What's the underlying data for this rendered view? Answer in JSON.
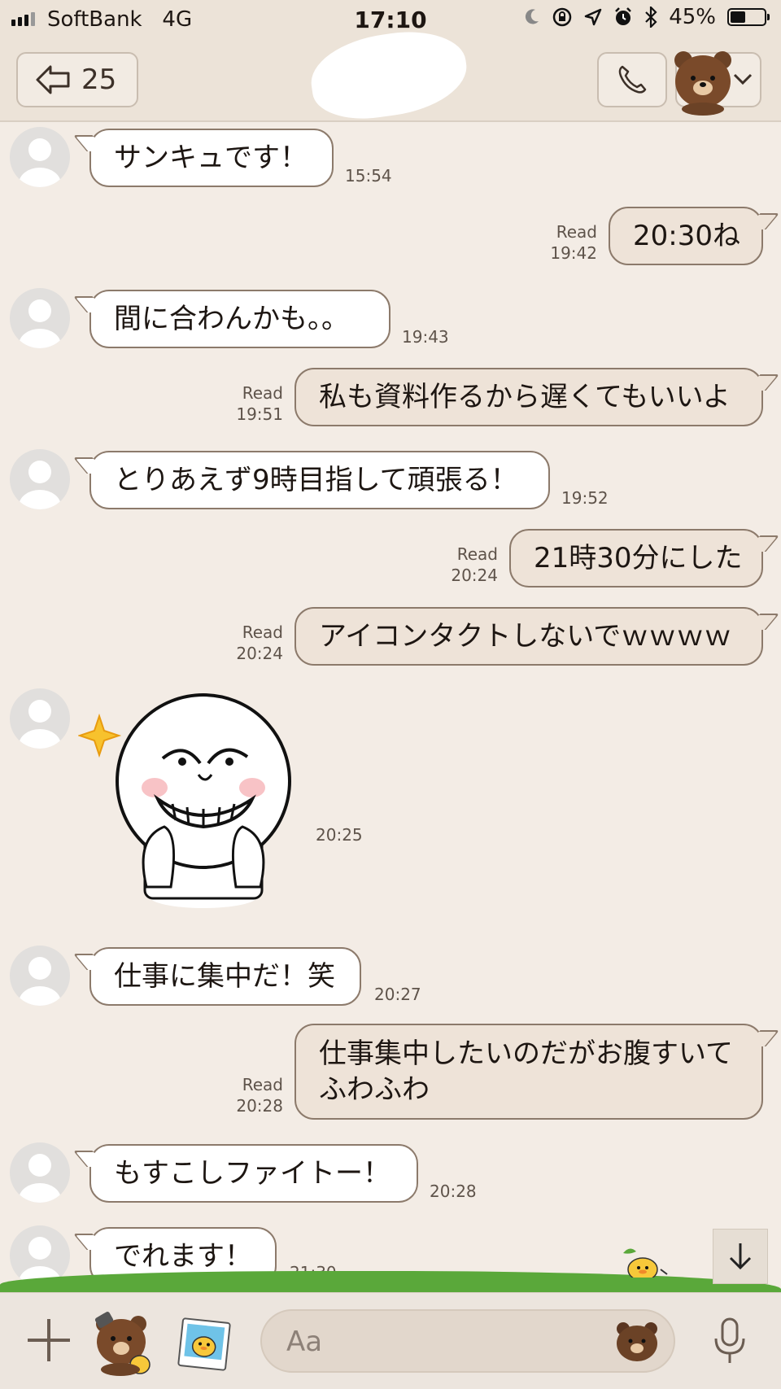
{
  "status": {
    "carrier": "SoftBank",
    "network": "4G",
    "time": "17:10",
    "battery": "45%",
    "battery_level": 0.45
  },
  "header": {
    "unread_count": "25"
  },
  "messages": [
    {
      "dir": "in",
      "text": "サンキュです！",
      "time": "15:54"
    },
    {
      "dir": "out",
      "text": "20:30ね",
      "time": "19:42",
      "read": "Read"
    },
    {
      "dir": "in",
      "text": "間に合わんかも。。",
      "time": "19:43"
    },
    {
      "dir": "out",
      "text": "私も資料作るから遅くてもいいよ",
      "time": "19:51",
      "read": "Read"
    },
    {
      "dir": "in",
      "text": "とりあえず9時目指して頑張る！",
      "time": "19:52"
    },
    {
      "dir": "out",
      "text": "21時30分にした",
      "time": "20:24",
      "read": "Read"
    },
    {
      "dir": "out",
      "text": "アイコンタクトしないでｗｗｗｗ",
      "time": "20:24",
      "read": "Read"
    },
    {
      "dir": "in",
      "type": "sticker",
      "time": "20:25"
    },
    {
      "dir": "in",
      "text": "仕事に集中だ！笑",
      "time": "20:27"
    },
    {
      "dir": "out",
      "text_line1": "仕事集中したいのだがお腹すいて",
      "text_line2": "ふわふわ",
      "time": "20:28",
      "read": "Read"
    },
    {
      "dir": "in",
      "text": "もすこしファイトー！",
      "time": "20:28"
    },
    {
      "dir": "in",
      "text": "でれます！",
      "time": "21:30"
    }
  ],
  "input": {
    "placeholder": "Aa"
  },
  "icons": {
    "back": "back-arrow-icon",
    "call": "phone-icon",
    "menu": "bear-avatar-icon",
    "plus": "plus-icon",
    "sticker": "sticker-icon",
    "photo": "photo-icon",
    "emoji": "emoji-icon",
    "mic": "microphone-icon",
    "scroll": "arrow-down-icon"
  },
  "colors": {
    "background": "#f3ece5",
    "incoming_bubble": "#ffffff",
    "outgoing_bubble": "#eee3d8",
    "bubble_border": "#8c7a6b"
  }
}
